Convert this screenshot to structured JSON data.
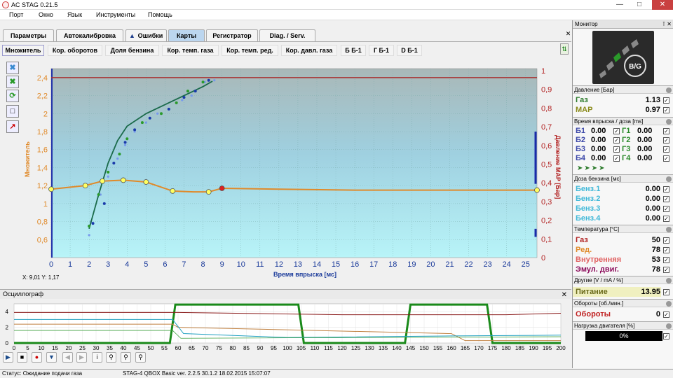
{
  "window": {
    "title": "AC STAG 0.21.5"
  },
  "menu": [
    "Порт",
    "Окно",
    "Язык",
    "Инструменты",
    "Помощь"
  ],
  "tabs": [
    "Параметры",
    "Автокалибровка",
    "Ошибки",
    "Карты",
    "Регистратор",
    "Diag. / Serv."
  ],
  "subtabs": [
    "Множитель",
    "Кор. оборотов",
    "Доля бензина",
    "Кор. темп. газа",
    "Кор. темп. ред.",
    "Кор. давл. газа",
    "Б Б-1",
    "Г Б-1",
    "D Б-1"
  ],
  "coords_text": "X: 9,01  Y: 1,17",
  "chart_data": {
    "type": "line",
    "xlabel": "Время впрыска [мс]",
    "ylabel_left": "Множитель",
    "ylabel_right": "Давление MAP [Бар]",
    "x_ticks": [
      0,
      1,
      2,
      3,
      4,
      5,
      6,
      7,
      8,
      9,
      10,
      11,
      12,
      13,
      14,
      15,
      16,
      17,
      18,
      19,
      20,
      21,
      22,
      23,
      24,
      25
    ],
    "y_left_ticks": [
      "0,6",
      "0,8",
      "1",
      "1,2",
      "1,4",
      "1,6",
      "1,8",
      "2",
      "2,2",
      "2,4"
    ],
    "y_right_ticks": [
      "0",
      "0,1",
      "0,2",
      "0,3",
      "0,4",
      "0,5",
      "0,6",
      "0,7",
      "0,8",
      "0,9",
      "1"
    ],
    "xlim": [
      0,
      25.6
    ],
    "ylim_left": [
      0.4,
      2.5
    ],
    "ylim_right": [
      0,
      1
    ],
    "multiplier_curve": [
      [
        0,
        1.16
      ],
      [
        1.8,
        1.2
      ],
      [
        2.7,
        1.25
      ],
      [
        3.8,
        1.26
      ],
      [
        5,
        1.24
      ],
      [
        6.4,
        1.14
      ],
      [
        7.5,
        1.13
      ],
      [
        8.3,
        1.13
      ],
      [
        9,
        1.17
      ],
      [
        12,
        1.16
      ],
      [
        16,
        1.15
      ],
      [
        20,
        1.15
      ],
      [
        25.6,
        1.15
      ]
    ],
    "multiplier_points": [
      [
        0,
        1.16
      ],
      [
        1.8,
        1.2
      ],
      [
        2.7,
        1.25
      ],
      [
        3.8,
        1.26
      ],
      [
        5,
        1.24
      ],
      [
        6.4,
        1.14
      ],
      [
        8.3,
        1.13
      ],
      [
        25.6,
        1.15
      ]
    ],
    "selected_point": [
      9,
      1.17
    ],
    "map_level": 2.4,
    "gas_curve": [
      [
        2,
        0.72
      ],
      [
        2.5,
        1.1
      ],
      [
        3,
        1.45
      ],
      [
        3.5,
        1.7
      ],
      [
        4,
        1.86
      ],
      [
        5,
        2.0
      ],
      [
        6,
        2.1
      ],
      [
        7,
        2.2
      ],
      [
        8,
        2.3
      ],
      [
        8.5,
        2.36
      ]
    ],
    "gas_points": [
      [
        2,
        0.75
      ],
      [
        2.2,
        0.78
      ],
      [
        2.5,
        1.1
      ],
      [
        2.8,
        1.0
      ],
      [
        3,
        1.35
      ],
      [
        3.3,
        1.45
      ],
      [
        3.6,
        1.55
      ],
      [
        3.9,
        1.68
      ],
      [
        4,
        1.72
      ],
      [
        4.4,
        1.82
      ],
      [
        4.8,
        1.9
      ],
      [
        5.2,
        1.95
      ],
      [
        5.8,
        2.0
      ],
      [
        6.2,
        2.05
      ],
      [
        6.6,
        2.12
      ],
      [
        7,
        2.18
      ],
      [
        7.2,
        2.25
      ],
      [
        7.6,
        2.25
      ],
      [
        8,
        2.35
      ],
      [
        8.3,
        2.37
      ]
    ],
    "petrol_points": [
      [
        2,
        0.65
      ],
      [
        2.1,
        0.8
      ],
      [
        2.6,
        1.1
      ],
      [
        3,
        1.3
      ],
      [
        3.5,
        1.5
      ],
      [
        3.9,
        1.65
      ],
      [
        4.4,
        1.8
      ],
      [
        5,
        1.9
      ],
      [
        5.6,
        2.0
      ],
      [
        6.2,
        2.05
      ],
      [
        6.9,
        2.15
      ],
      [
        7.4,
        2.2
      ],
      [
        8.1,
        2.35
      ],
      [
        8.6,
        2.37
      ]
    ]
  },
  "osc": {
    "title": "Осциллограф",
    "y_ticks": [
      "4",
      "2",
      "0"
    ],
    "x_ticks": [
      "0",
      "5",
      "10",
      "15",
      "20",
      "25",
      "30",
      "35",
      "40",
      "45",
      "50",
      "55",
      "60",
      "65",
      "70",
      "75",
      "80",
      "85",
      "90",
      "95",
      "100",
      "105",
      "110",
      "115",
      "120",
      "125",
      "130",
      "135",
      "140",
      "145",
      "150",
      "155",
      "160",
      "165",
      "170",
      "175",
      "180",
      "185",
      "190",
      "195",
      "200"
    ]
  },
  "status": {
    "label": "Статус: Ожидание подачи газа",
    "device": "STAG-4 QBOX Basic  ver. 2.2.5  30.1.2  18.02.2015 15:07:07"
  },
  "monitor": {
    "title": "Монитор",
    "logo_text": "B/G",
    "pressure": {
      "header": "Давление [Бар]",
      "gas_label": "Газ",
      "gas_value": "1.13",
      "map_label": "MAP",
      "map_value": "0.97"
    },
    "injection": {
      "header": "Время впрыска / доза [ms]",
      "rows": [
        {
          "b": "Б1",
          "bv": "0.00",
          "g": "Г1",
          "gv": "0.00"
        },
        {
          "b": "Б2",
          "bv": "0.00",
          "g": "Г2",
          "gv": "0.00"
        },
        {
          "b": "Б3",
          "bv": "0.00",
          "g": "Г3",
          "gv": "0.00"
        },
        {
          "b": "Б4",
          "bv": "0.00",
          "g": "Г4",
          "gv": "0.00"
        }
      ]
    },
    "petrol_dose": {
      "header": "Доза бензина [мс]",
      "rows": [
        {
          "label": "Бенз.1",
          "value": "0.00"
        },
        {
          "label": "Бенз.2",
          "value": "0.00"
        },
        {
          "label": "Бенз.3",
          "value": "0.00"
        },
        {
          "label": "Бенз.4",
          "value": "0.00"
        }
      ]
    },
    "temperature": {
      "header": "Температура [°C]",
      "rows": [
        {
          "label": "Газ",
          "value": "50",
          "color": "#b22222"
        },
        {
          "label": "Ред.",
          "value": "78",
          "color": "#e08a2a"
        },
        {
          "label": "Внутренняя",
          "value": "53",
          "color": "#e06060"
        },
        {
          "label": "Эмул. двиг.",
          "value": "78",
          "color": "#8b0a5a"
        }
      ]
    },
    "other": {
      "header": "Другие [V / mA / %]",
      "power_label": "Питание",
      "power_value": "13.95"
    },
    "rpm": {
      "header": "Обороты [об./мин.]",
      "label": "Обороты",
      "value": "0"
    },
    "load": {
      "header": "Нагрузка двигателя [%]",
      "value": "0%"
    }
  }
}
